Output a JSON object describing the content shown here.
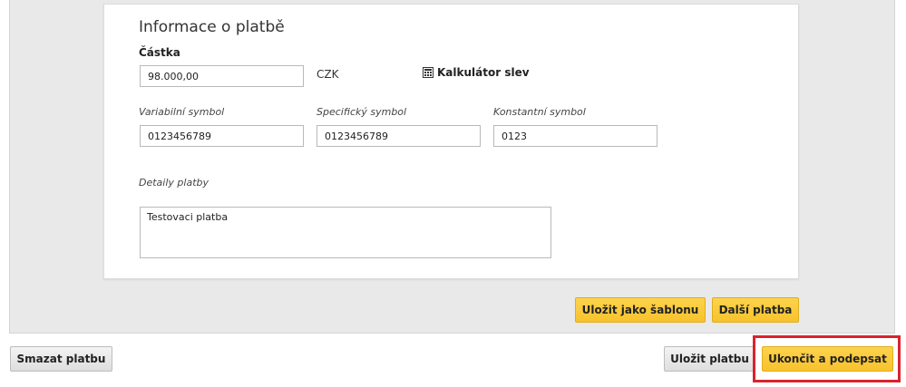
{
  "section": {
    "title": "Informace o platbě",
    "amount_label": "Částka",
    "amount_value": "98.000,00",
    "currency": "CZK",
    "calculator_label": "Kalkulátor slev",
    "calculator_icon": "calculator-icon"
  },
  "symbols": {
    "variable_label": "Variabilní symbol",
    "variable_value": "0123456789",
    "specific_label": "Specifický symbol",
    "specific_value": "0123456789",
    "constant_label": "Konstantní symbol",
    "constant_value": "0123"
  },
  "details": {
    "label": "Detaily platby",
    "value": "Testovaci platba"
  },
  "panel_actions": {
    "save_template_label": "Uložit jako šablonu",
    "next_payment_label": "Další platba"
  },
  "footer_actions": {
    "delete_label": "Smazat platbu",
    "save_label": "Uložit platbu",
    "finish_sign_label": "Ukončit a podepsat"
  },
  "colors": {
    "primary_button": "#fbc93b",
    "highlight_border": "#d9232e"
  }
}
